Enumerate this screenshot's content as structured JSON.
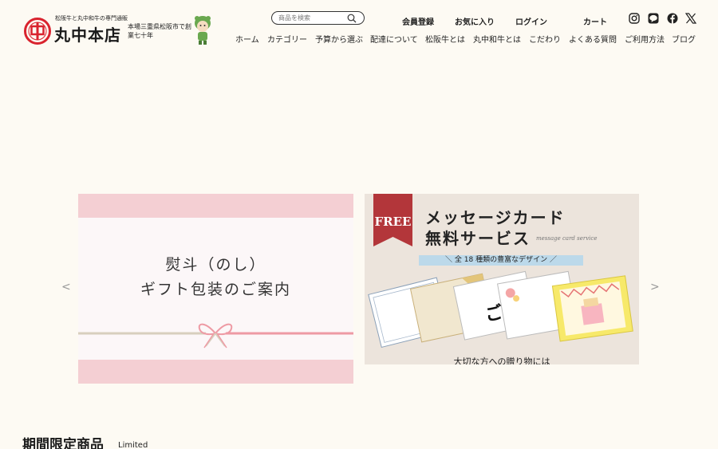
{
  "header": {
    "tagline": "松阪牛と丸中和牛の専門通販",
    "shop_name": "丸中本店",
    "subtitle": "本場三重県松阪市で創業七十年",
    "seal_char": "中"
  },
  "search": {
    "placeholder": "商品を検索"
  },
  "utility_nav": {
    "register": "会員登録",
    "favorites": "お気に入り",
    "login": "ログイン",
    "cart": "カート"
  },
  "social_icons": [
    "instagram-icon",
    "line-icon",
    "facebook-icon",
    "x-icon"
  ],
  "main_nav": [
    "ホーム",
    "カテゴリー",
    "予算から選ぶ",
    "配達について",
    "松阪牛とは",
    "丸中和牛とは",
    "こだわり",
    "よくある質問",
    "ご利用方法",
    "ブログ"
  ],
  "carousel": {
    "prev": "<",
    "next": ">",
    "slide1": {
      "line1": "熨斗（のし）",
      "line2": "ギフト包装のご案内"
    },
    "slide2": {
      "free": "FREE",
      "title1": "メッセージカード",
      "title2": "無料サービス",
      "script": "message card service",
      "band": "＼ 全 18 種類の豊富なデザイン ／",
      "bottom": "大切な方への贈り物には",
      "card_text": "ご祝"
    }
  },
  "section": {
    "title": "期間限定商品",
    "subtitle": "Limited"
  },
  "colors": {
    "seal_red": "#d9232e",
    "pink_band": "#f4cfd3",
    "free_red": "#b3363a",
    "blue_band": "#bcd9ea"
  }
}
